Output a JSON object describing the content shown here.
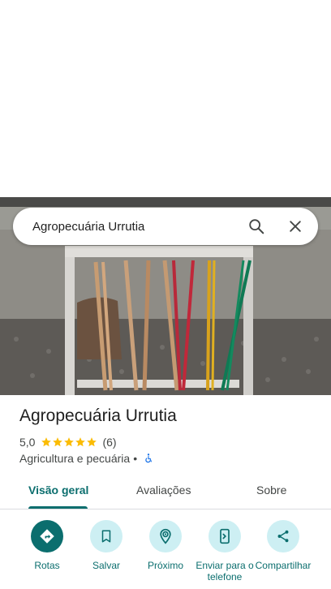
{
  "search": {
    "query": "Agropecuária Urrutia"
  },
  "place": {
    "name": "Agropecuária Urrutia",
    "rating": "5,0",
    "stars": 5,
    "review_count": "(6)",
    "category": "Agricultura e pecuária",
    "separator": "•"
  },
  "tabs": [
    {
      "label": "Visão geral",
      "active": true
    },
    {
      "label": "Avaliações",
      "active": false
    },
    {
      "label": "Sobre",
      "active": false
    }
  ],
  "actions": [
    {
      "label": "Rotas",
      "icon": "directions-icon"
    },
    {
      "label": "Salvar",
      "icon": "bookmark-icon"
    },
    {
      "label": "Próximo",
      "icon": "nearby-icon"
    },
    {
      "label": "Enviar para o telefone",
      "icon": "send-to-phone-icon"
    },
    {
      "label": "Compartilhar",
      "icon": "share-icon"
    }
  ],
  "colors": {
    "accent": "#0b6e6e",
    "action_bg": "#cdeff3",
    "star": "#fbbc04",
    "a11y": "#1a73e8"
  }
}
